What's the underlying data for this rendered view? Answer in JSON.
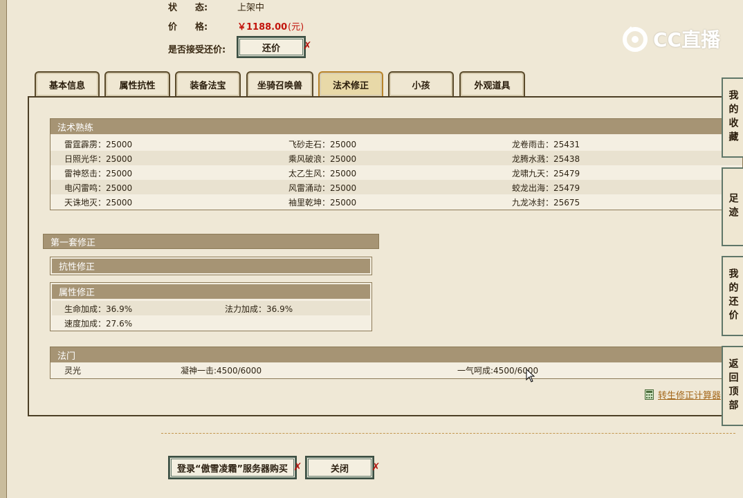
{
  "info": {
    "status_label": "状　　态:",
    "status_value": "上架中",
    "price_label": "价　　格:",
    "price_value": "￥1188.00",
    "price_unit": "(元)",
    "bargain_label": "是否接受还价:",
    "bargain_button": "还价"
  },
  "logo": {
    "text": "CC直播"
  },
  "tabs": [
    {
      "label": "基本信息"
    },
    {
      "label": "属性抗性"
    },
    {
      "label": "装备法宝"
    },
    {
      "label": "坐骑召唤兽"
    },
    {
      "label": "法术修正",
      "active": true
    },
    {
      "label": "小孩"
    },
    {
      "label": "外观道具"
    }
  ],
  "spell_mastery": {
    "title": "法术熟练",
    "rows": [
      [
        "雷霆霹雳：25000",
        "飞砂走石：25000",
        "龙卷雨击：25431"
      ],
      [
        "日照光华：25000",
        "乘风破浪：25000",
        "龙腾水溅：25438"
      ],
      [
        "雷神怒击：25000",
        "太乙生风：25000",
        "龙啸九天：25479"
      ],
      [
        "电闪雷鸣：25000",
        "风雷涌动：25000",
        "蛟龙出海：25479"
      ],
      [
        "天诛地灭：25000",
        "袖里乾坤：25000",
        "九龙冰封：25675"
      ]
    ]
  },
  "first_set": {
    "title": "第一套修正",
    "resist_title": "抗性修正",
    "attr_title": "属性修正",
    "attr_rows": [
      [
        "生命加成：36.9%",
        "法力加成：36.9%"
      ],
      [
        "速度加成：27.6%",
        ""
      ]
    ]
  },
  "school": {
    "title": "法门",
    "items": [
      "灵光",
      "凝神一击:4500/6000",
      "一气呵成:4500/6000"
    ]
  },
  "calculator_link": "转生修正计算器",
  "sidebar": [
    "我的收藏",
    "足迹",
    "我的还价",
    "返回顶部"
  ],
  "footer": {
    "buy_button": "登录“傲雪凌霜”服务器购买",
    "close_button": "关闭"
  },
  "colors": {
    "price": "#c2140c",
    "section_head": "#a69474",
    "button_border": "#5f7668",
    "link": "#a4681c"
  },
  "icons": {
    "calculator": "calculator-icon",
    "logo": "cc-logo-icon",
    "cursor": "mouse-cursor-icon"
  }
}
